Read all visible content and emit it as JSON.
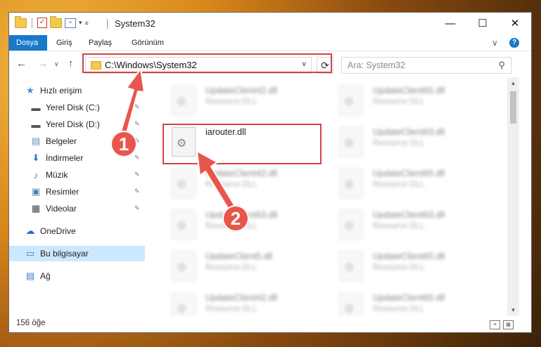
{
  "window": {
    "title": "System32",
    "minimize_glyph": "—",
    "maximize_glyph": "☐",
    "close_glyph": "✕"
  },
  "ribbon": {
    "tabs": [
      "Dosya",
      "Giriş",
      "Paylaş",
      "Görünüm"
    ],
    "active_tab": "Dosya",
    "expand_glyph": "∨",
    "help_glyph": "?"
  },
  "address": {
    "path": "C:\\Windows\\System32",
    "dropdown_glyph": "∨",
    "refresh_glyph": "⟳"
  },
  "search": {
    "placeholder": "Ara: System32",
    "icon_glyph": "⚲"
  },
  "nav_buttons": {
    "back": "←",
    "forward": "→",
    "recent": "∨",
    "up": "↑"
  },
  "sidebar": {
    "items": [
      {
        "label": "Hızlı erişim",
        "icon": "star-icon",
        "glyph": "★",
        "color": "#3b8ee0",
        "pinned": false
      },
      {
        "label": "Yerel Disk (C:)",
        "icon": "drive-icon",
        "glyph": "▬",
        "color": "#555555",
        "pinned": true
      },
      {
        "label": "Yerel Disk (D:)",
        "icon": "drive-icon",
        "glyph": "▬",
        "color": "#555555",
        "pinned": true
      },
      {
        "label": "Belgeler",
        "icon": "documents-icon",
        "glyph": "▤",
        "color": "#6a8fbf",
        "pinned": true
      },
      {
        "label": "İndirmeler",
        "icon": "downloads-icon",
        "glyph": "⬇",
        "color": "#2d7fd6",
        "pinned": true
      },
      {
        "label": "Müzik",
        "icon": "music-icon",
        "glyph": "♪",
        "color": "#2d7fd6",
        "pinned": true
      },
      {
        "label": "Resimler",
        "icon": "pictures-icon",
        "glyph": "▣",
        "color": "#4a7fb0",
        "pinned": true
      },
      {
        "label": "Videolar",
        "icon": "videos-icon",
        "glyph": "▦",
        "color": "#444444",
        "pinned": true
      },
      {
        "label": "OneDrive",
        "icon": "cloud-icon",
        "glyph": "☁",
        "color": "#1f6fd1",
        "pinned": false
      },
      {
        "label": "Bu bilgisayar",
        "icon": "computer-icon",
        "glyph": "▭",
        "color": "#3a7bc8",
        "pinned": false,
        "selected": true
      },
      {
        "label": "Ağ",
        "icon": "network-icon",
        "glyph": "▤",
        "color": "#3a7bc8",
        "pinned": false
      }
    ],
    "pin_glyph": "✎"
  },
  "files": [
    {
      "name": "UpdateClient42.dll",
      "type": "Resource DLL",
      "blurred": true
    },
    {
      "name": "UpdateClient65.dll",
      "type": "Resource DLL",
      "blurred": true
    },
    {
      "name": "iarouter.dll",
      "type": "",
      "blurred": false
    },
    {
      "name": "UpdateClient63.dll",
      "type": "Resource DLL",
      "blurred": true
    },
    {
      "name": "UpdateClient42.dll",
      "type": "Resource DLL",
      "blurred": true
    },
    {
      "name": "UpdateClient65.dll",
      "type": "Resource DLL",
      "blurred": true
    },
    {
      "name": "UpdateClient63.dll",
      "type": "Resource DLL",
      "blurred": true
    },
    {
      "name": "UpdateClient63.dll",
      "type": "Resource DLL",
      "blurred": true
    },
    {
      "name": "UpdateClient5.dll",
      "type": "Resource DLL",
      "blurred": true
    },
    {
      "name": "UpdateClient65.dll",
      "type": "Resource DLL",
      "blurred": true
    },
    {
      "name": "UpdateClient42.dll",
      "type": "Resource DLL",
      "blurred": true
    },
    {
      "name": "UpdateClient65.dll",
      "type": "Resource DLL",
      "blurred": true
    }
  ],
  "status": {
    "count": "156 öğe"
  },
  "annotations": {
    "step1": "1",
    "step2": "2",
    "color": "#e8564b"
  }
}
